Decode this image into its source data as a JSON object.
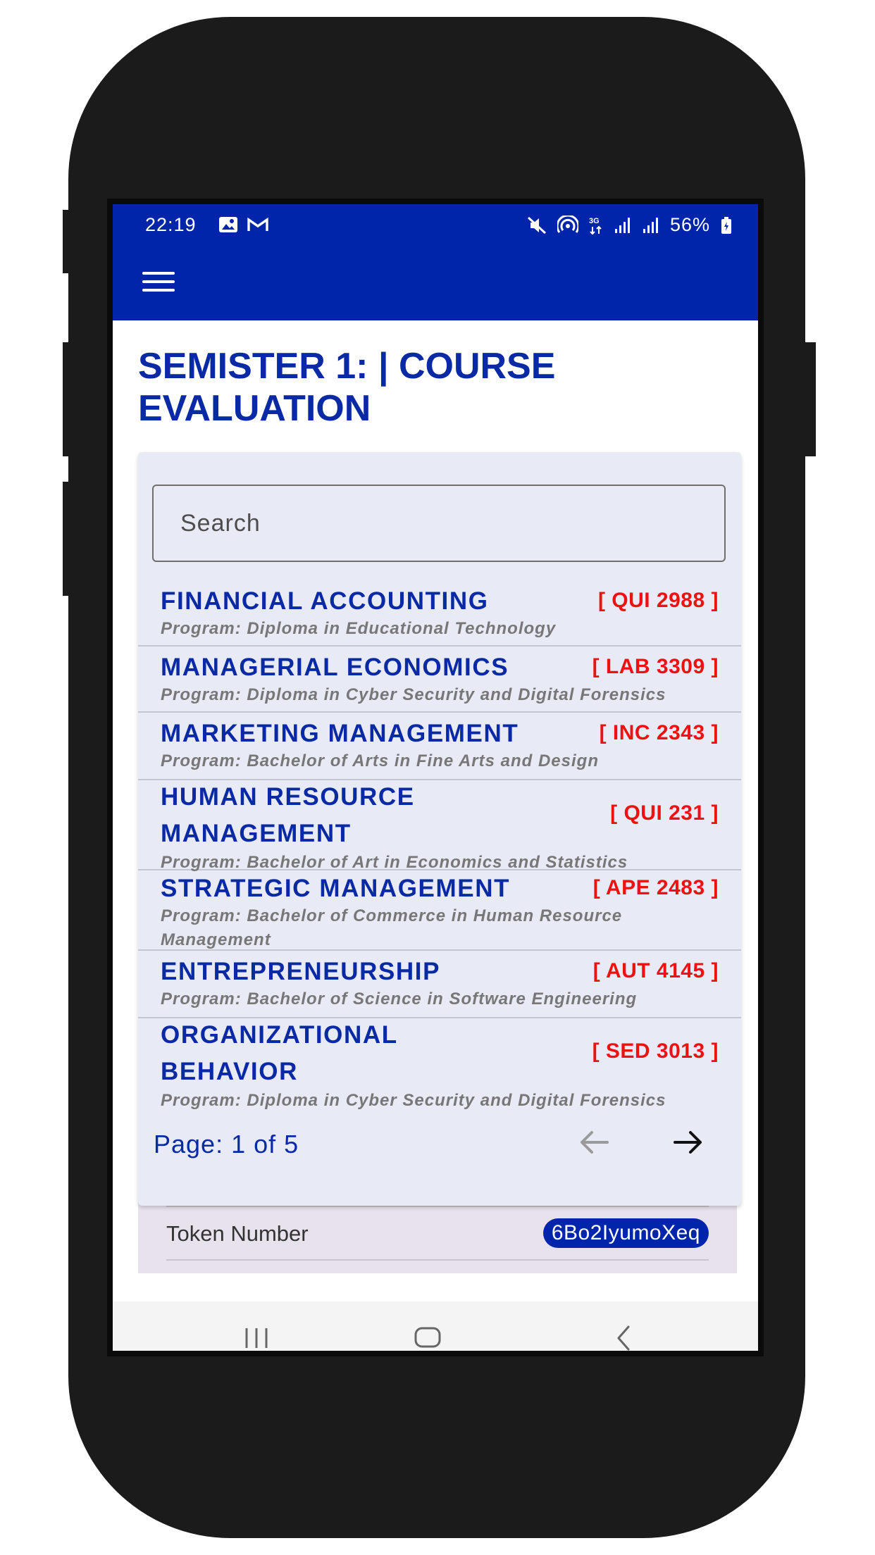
{
  "status_bar": {
    "time": "22:19",
    "battery": "56%"
  },
  "page": {
    "title": "SEMISTER 1: | COURSE EVALUATION"
  },
  "search": {
    "placeholder": "Search"
  },
  "courses": [
    {
      "name": "FINANCIAL ACCOUNTING",
      "code": "[ QUI 2988 ]",
      "program": "Program: Diploma in Educational Technology"
    },
    {
      "name": "MANAGERIAL ECONOMICS",
      "code": "[ LAB 3309 ]",
      "program": "Program: Diploma in Cyber Security and Digital Forensics"
    },
    {
      "name": "MARKETING MANAGEMENT",
      "code": "[ INC 2343 ]",
      "program": "Program: Bachelor of Arts in Fine Arts and Design"
    },
    {
      "name": "HUMAN RESOURCE MANAGEMENT",
      "code": "[ QUI 231 ]",
      "program": "Program: Bachelor of Art in Economics and Statistics"
    },
    {
      "name": "STRATEGIC MANAGEMENT",
      "code": "[ APE 2483 ]",
      "program": "Program: Bachelor of Commerce in Human Resource Management"
    },
    {
      "name": "ENTREPRENEURSHIP",
      "code": "[ AUT 4145 ]",
      "program": "Program: Bachelor of Science in Software Engineering"
    },
    {
      "name": "ORGANIZATIONAL BEHAVIOR",
      "code": "[ SED 3013 ]",
      "program": "Program: Diploma in Cyber Security and Digital Forensics"
    }
  ],
  "pagination": {
    "label": "Page: 1 of 5"
  },
  "token": {
    "label": "Token Number",
    "value": "6Bo2IyumoXeq"
  },
  "colors": {
    "primary": "#0025aa",
    "code_red": "#ee1111",
    "card_bg": "#e8eaf6"
  }
}
